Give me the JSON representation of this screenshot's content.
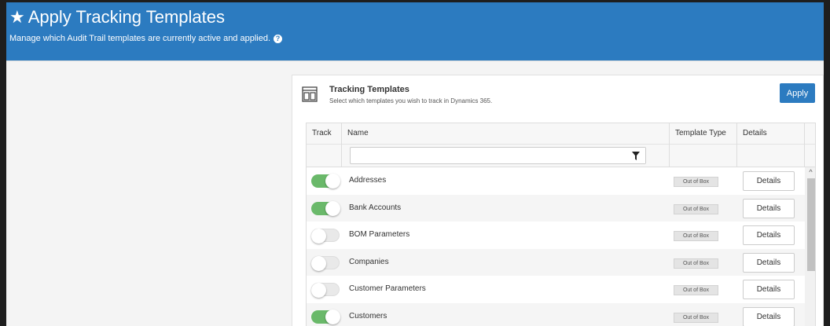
{
  "header": {
    "title": "Apply Tracking Templates",
    "subtitle": "Manage which Audit Trail templates are currently active and applied.",
    "help_glyph": "?",
    "star_glyph": "★"
  },
  "panel": {
    "title": "Tracking Templates",
    "subtitle": "Select which templates you wish to track in Dynamics 365.",
    "apply_label": "Apply"
  },
  "table": {
    "columns": {
      "track": "Track",
      "name": "Name",
      "type": "Template Type",
      "details": "Details"
    },
    "filter": {
      "value": "",
      "placeholder": ""
    },
    "rows": [
      {
        "name": "Addresses",
        "tracked": true,
        "type": "Out of Box",
        "details_label": "Details"
      },
      {
        "name": "Bank Accounts",
        "tracked": true,
        "type": "Out of Box",
        "details_label": "Details"
      },
      {
        "name": "BOM Parameters",
        "tracked": false,
        "type": "Out of Box",
        "details_label": "Details"
      },
      {
        "name": "Companies",
        "tracked": false,
        "type": "Out of Box",
        "details_label": "Details"
      },
      {
        "name": "Customer Parameters",
        "tracked": false,
        "type": "Out of Box",
        "details_label": "Details"
      },
      {
        "name": "Customers",
        "tracked": true,
        "type": "Out of Box",
        "details_label": "Details"
      }
    ]
  },
  "colors": {
    "header_bg": "#2c7bc0",
    "toggle_on": "#6ab96a",
    "toggle_off": "#e9e9e9"
  },
  "icons": {
    "header": "star-icon",
    "help": "help-icon",
    "panel": "template-grid-icon",
    "filter": "filter-icon",
    "scroll": "chevron-up-icon"
  }
}
